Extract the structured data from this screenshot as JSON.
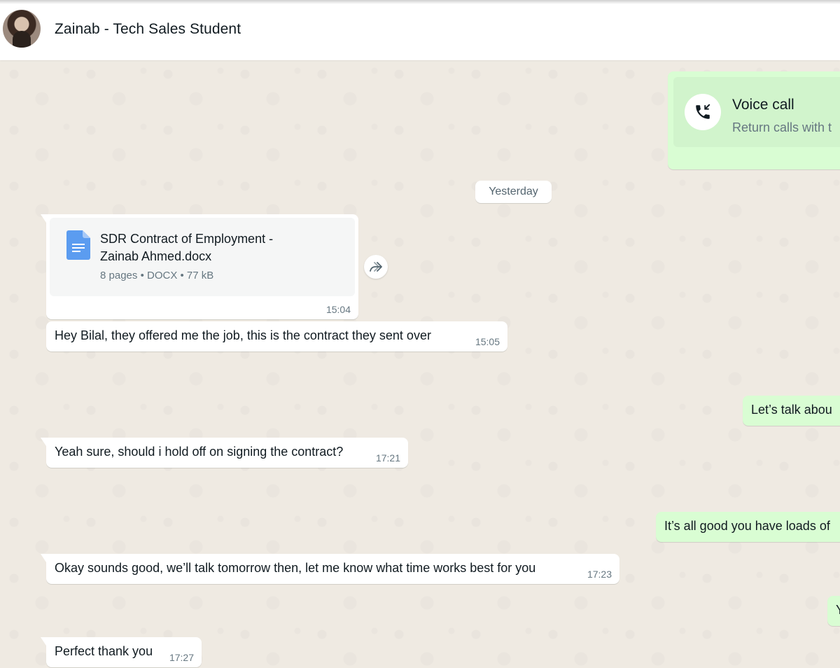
{
  "header": {
    "contact_name": "Zainab - Tech Sales Student"
  },
  "call_card": {
    "title": "Voice call",
    "subtitle": "Return calls with t"
  },
  "date_divider": "Yesterday",
  "document": {
    "name": "SDR Contract of Employment - Zainab Ahmed.docx",
    "pages": "8 pages",
    "type": "DOCX",
    "size": "77 kB",
    "time": "15:04"
  },
  "messages": [
    {
      "direction": "incoming",
      "text": "Hey Bilal, they offered me the job, this is the contract they sent over",
      "time": "15:05"
    },
    {
      "direction": "outgoing",
      "text": "Let’s talk abou",
      "time": ""
    },
    {
      "direction": "incoming",
      "text": "Yeah sure, should i hold off on signing the contract?",
      "time": "17:21"
    },
    {
      "direction": "outgoing",
      "text": "It’s all good you have loads of",
      "time": ""
    },
    {
      "direction": "incoming",
      "text": "Okay sounds good, we’ll talk tomorrow then, let me know what time works best for you",
      "time": "17:23"
    },
    {
      "direction": "outgoing",
      "text": "Y",
      "time": ""
    },
    {
      "direction": "incoming",
      "text": "Perfect thank you",
      "time": "17:27"
    }
  ],
  "colors": {
    "incoming_bubble": "#ffffff",
    "outgoing_bubble": "#d9fdd3",
    "chat_background": "#efeae2",
    "doc_icon": "#5b9cf0"
  },
  "icons": {
    "call": "phone-call-icon",
    "document": "docx-file-icon",
    "forward": "forward-icon"
  }
}
